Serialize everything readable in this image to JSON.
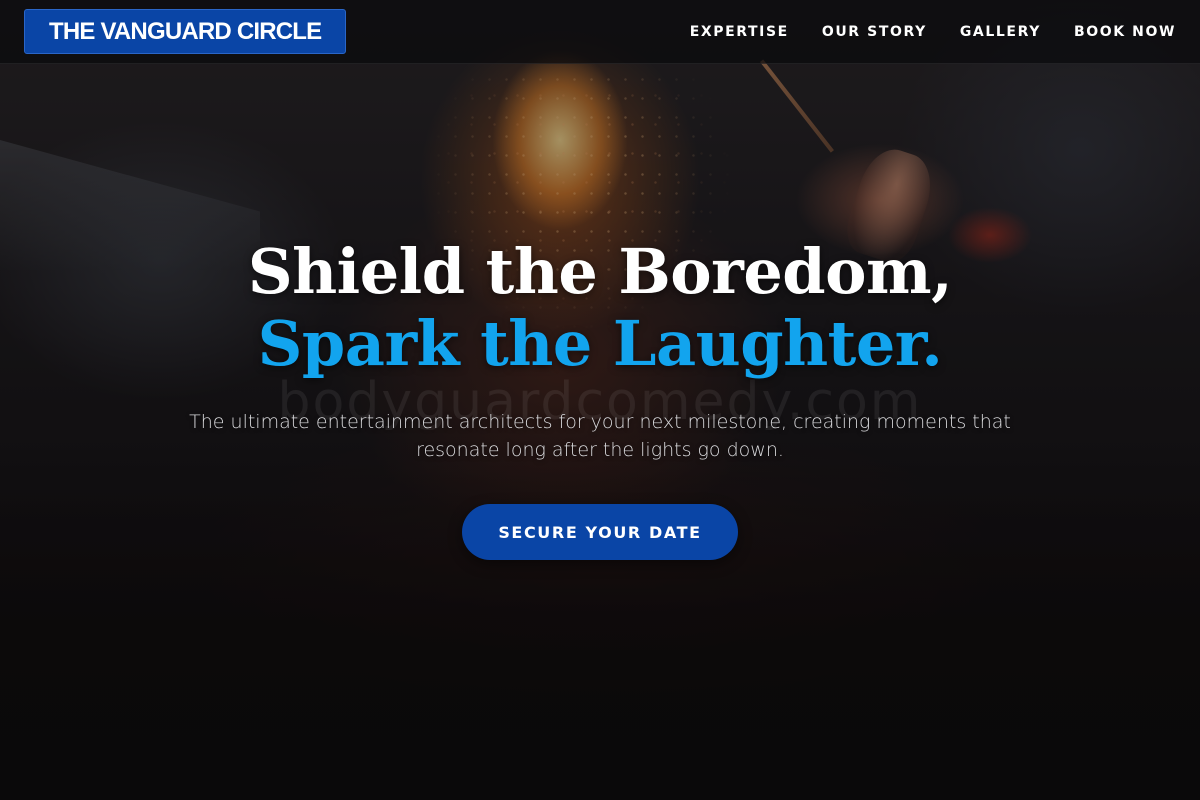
{
  "nav": {
    "brand": "THE VANGUARD CIRCLE",
    "links": [
      {
        "label": "EXPERTISE"
      },
      {
        "label": "OUR STORY"
      },
      {
        "label": "GALLERY"
      },
      {
        "label": "BOOK NOW"
      }
    ]
  },
  "hero": {
    "headline_line1": "Shield the Boredom,",
    "headline_line2": "Spark the Laughter.",
    "watermark": "bodyguardcomedy.com",
    "subtitle": "The ultimate entertainment architects for your next milestone, creating moments that resonate long after the lights go down.",
    "cta_label": "SECURE YOUR DATE"
  },
  "colors": {
    "brand_blue": "#0a45a6",
    "accent_cyan": "#12a4ee",
    "nav_bg": "#0a0a0c",
    "text_light": "#d9d9dc"
  }
}
